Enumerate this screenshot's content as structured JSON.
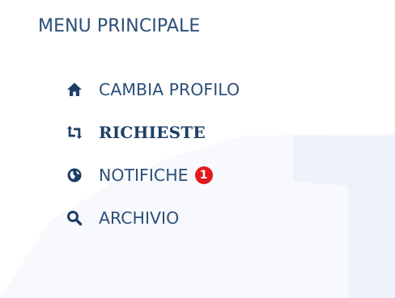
{
  "menu": {
    "title": "MENU PRINCIPALE",
    "items": [
      {
        "label": "CAMBIA PROFILO",
        "icon": "home-icon",
        "active": false
      },
      {
        "label": "RICHIESTE",
        "icon": "retweet-icon",
        "active": true
      },
      {
        "label": "NOTIFICHE",
        "icon": "globe-icon",
        "active": false,
        "badge": "1"
      },
      {
        "label": "ARCHIVIO",
        "icon": "search-icon",
        "active": false
      }
    ]
  },
  "colors": {
    "text": "#2c4f78",
    "active_text": "#1f3e66",
    "icon": "#1f3e66",
    "badge": "#e2191d",
    "background_shape": "#f2f5fb"
  }
}
